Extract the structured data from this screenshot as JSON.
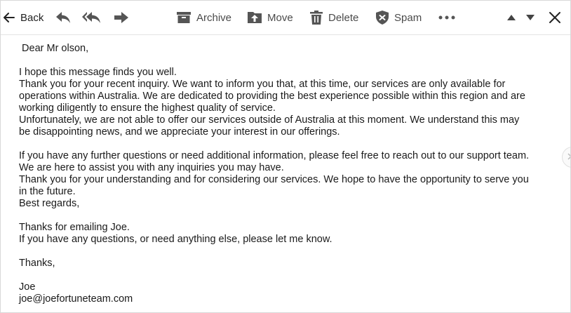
{
  "toolbar": {
    "back_label": "Back",
    "archive_label": "Archive",
    "move_label": "Move",
    "delete_label": "Delete",
    "spam_label": "Spam",
    "icons": [
      "back-arrow-icon",
      "reply-icon",
      "reply-all-icon",
      "forward-icon",
      "archive-icon",
      "move-icon",
      "delete-icon",
      "spam-icon",
      "more-icon",
      "chevron-up-icon",
      "chevron-down-icon",
      "close-icon"
    ]
  },
  "message": {
    "lines": [
      " Dear Mr olson,",
      "",
      "I hope this message finds you well.",
      "Thank you for your recent inquiry. We want to inform you that, at this time, our services are only available for",
      "operations within Australia. We are dedicated to providing the best experience possible within this region and are",
      "working diligently to ensure the highest quality of service.",
      "Unfortunately, we are not able to offer our services outside of Australia at this moment. We understand this may",
      "be disappointing news, and we appreciate your interest in our offerings.",
      "",
      "If you have any further questions or need additional information, please feel free to reach out to our support team.",
      "We are here to assist you with any inquiries you may have.",
      "Thank you for your understanding and for considering our services. We hope to have the opportunity to serve you",
      "in the future.",
      "Best regards,",
      "",
      "Thanks for emailing Joe.",
      "If you have any questions, or need anything else, please let me know.",
      "",
      "Thanks,",
      "",
      "Joe",
      "joe@joefortuneteam.com"
    ]
  },
  "colors": {
    "icon": "#555555",
    "text": "#1a1a1a",
    "border": "#d8d8d8"
  }
}
